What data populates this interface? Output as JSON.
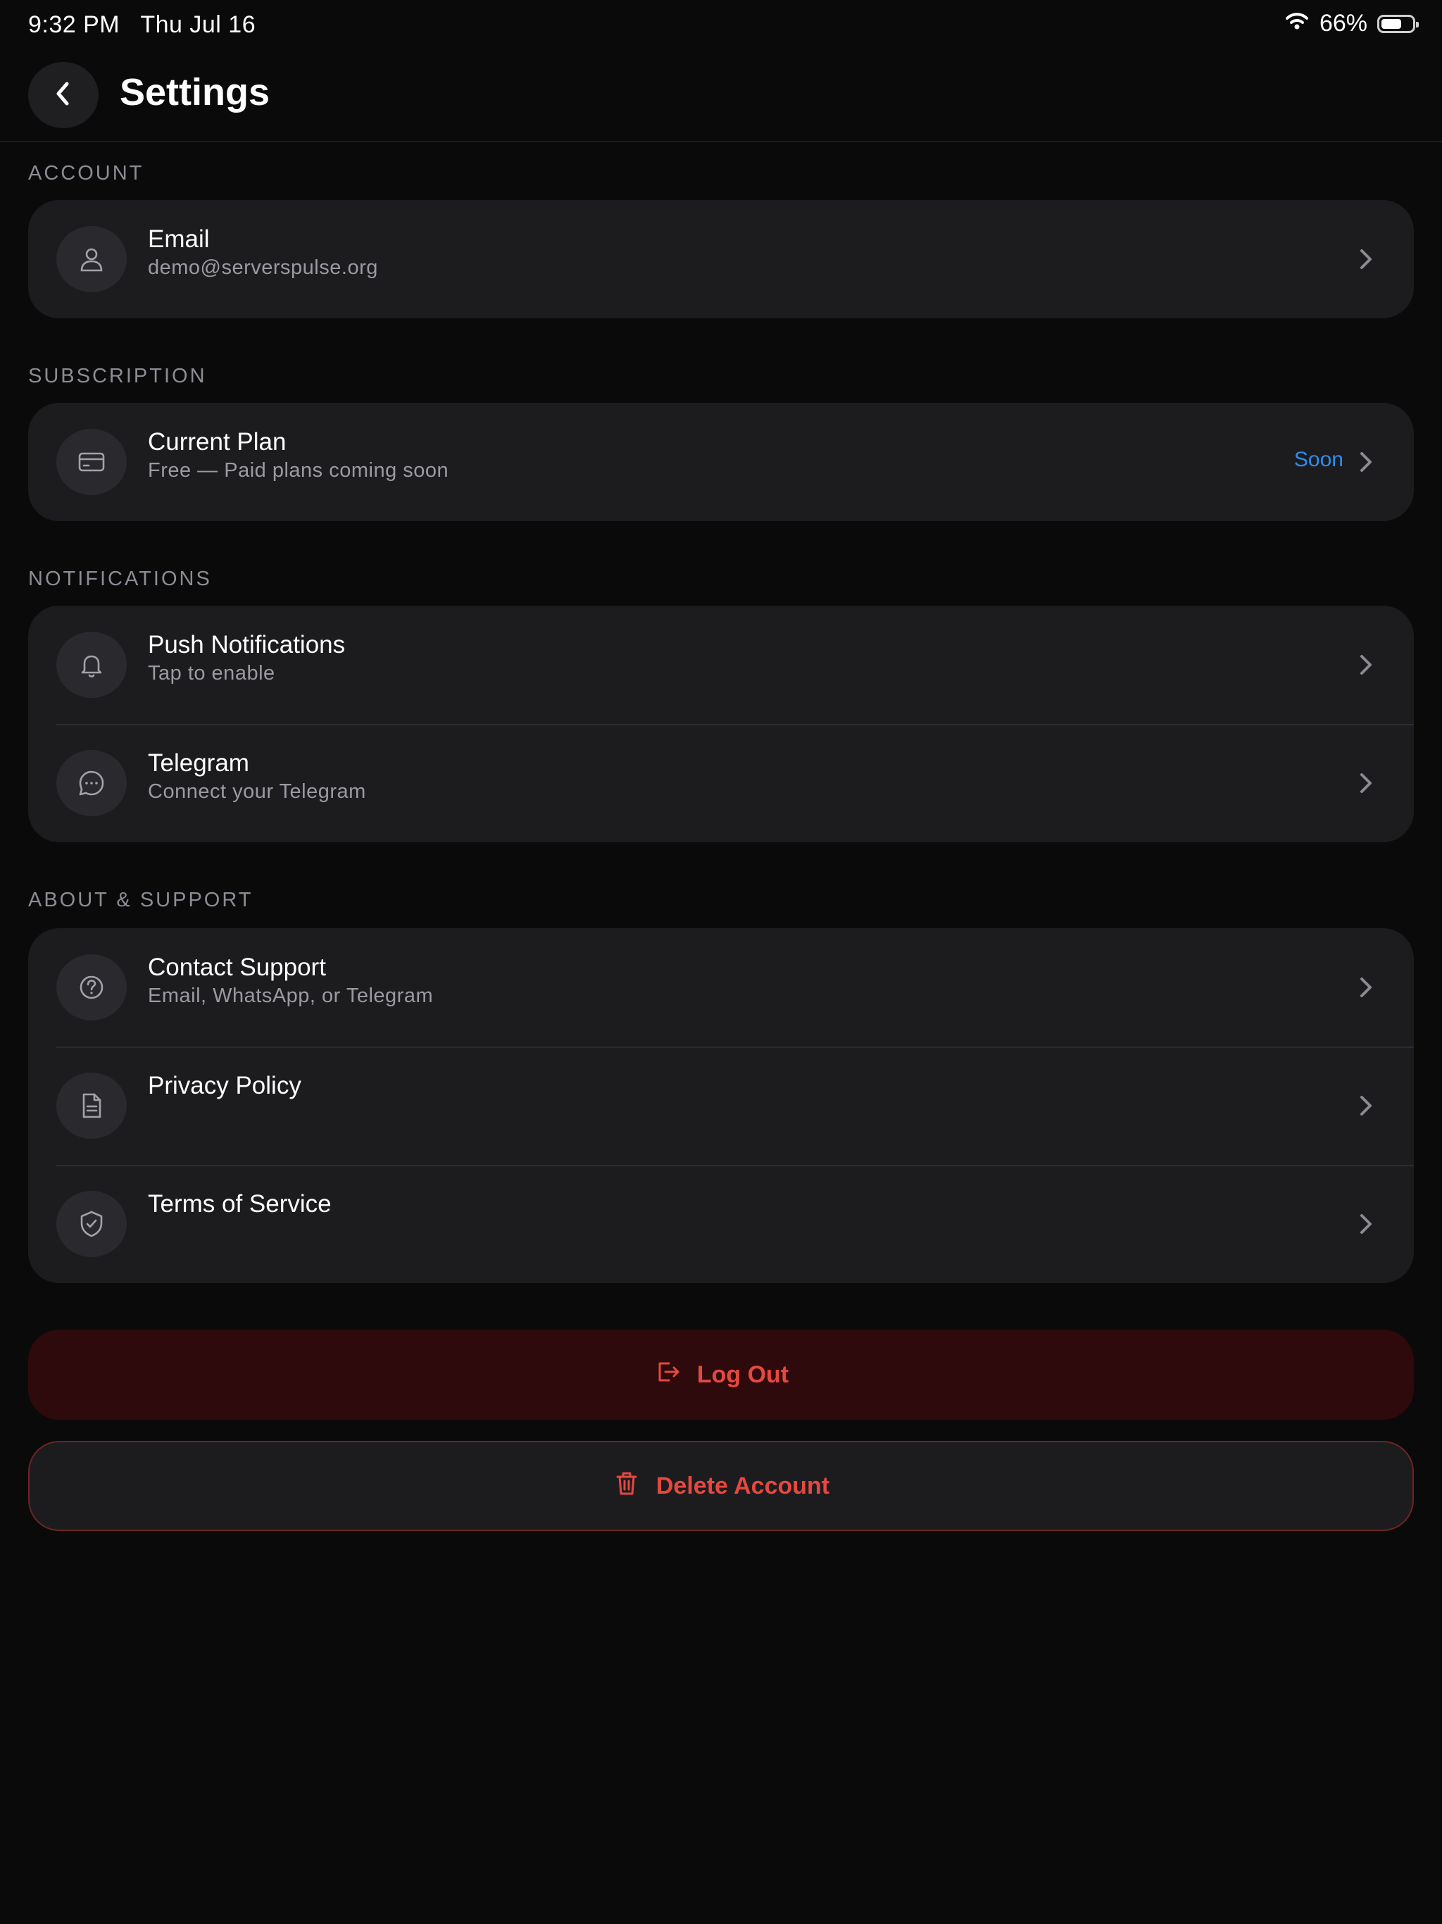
{
  "status_bar": {
    "time": "9:32 PM   Thu Jul 16",
    "battery_text": "66%",
    "battery_level": 0.66
  },
  "header": {
    "title": "Settings",
    "back_icon": "chevron-left-icon"
  },
  "sections": {
    "account": {
      "label": "ACCOUNT",
      "items": [
        {
          "icon": "user-icon",
          "title": "Email",
          "subtitle": "demo@serverspulse.org"
        }
      ]
    },
    "subscription": {
      "label": "SUBSCRIPTION",
      "items": [
        {
          "icon": "credit-card-icon",
          "title": "Current Plan",
          "subtitle": "Free — Paid plans coming soon",
          "badge": "Soon"
        }
      ]
    },
    "notifications": {
      "label": "NOTIFICATIONS",
      "items": [
        {
          "icon": "bell-icon",
          "title": "Push Notifications",
          "subtitle": "Tap to enable"
        },
        {
          "icon": "chat-bubble-icon",
          "title": "Telegram",
          "subtitle": "Connect your Telegram"
        }
      ]
    },
    "about": {
      "label": "ABOUT & SUPPORT",
      "items": [
        {
          "icon": "question-circle-icon",
          "title": "Contact Support",
          "subtitle": "Email, WhatsApp, or Telegram"
        },
        {
          "icon": "document-icon",
          "title": "Privacy Policy",
          "subtitle": ""
        },
        {
          "icon": "shield-check-icon",
          "title": "Terms of Service",
          "subtitle": ""
        }
      ]
    }
  },
  "actions": {
    "logout_label": "Log Out",
    "delete_label": "Delete Account"
  },
  "colors": {
    "background": "#0a0a0b",
    "card": "#1c1c1f",
    "accent_blue": "#2f8cf0",
    "danger_red": "#e5483f",
    "logout_bg": "#2e0a0c"
  }
}
